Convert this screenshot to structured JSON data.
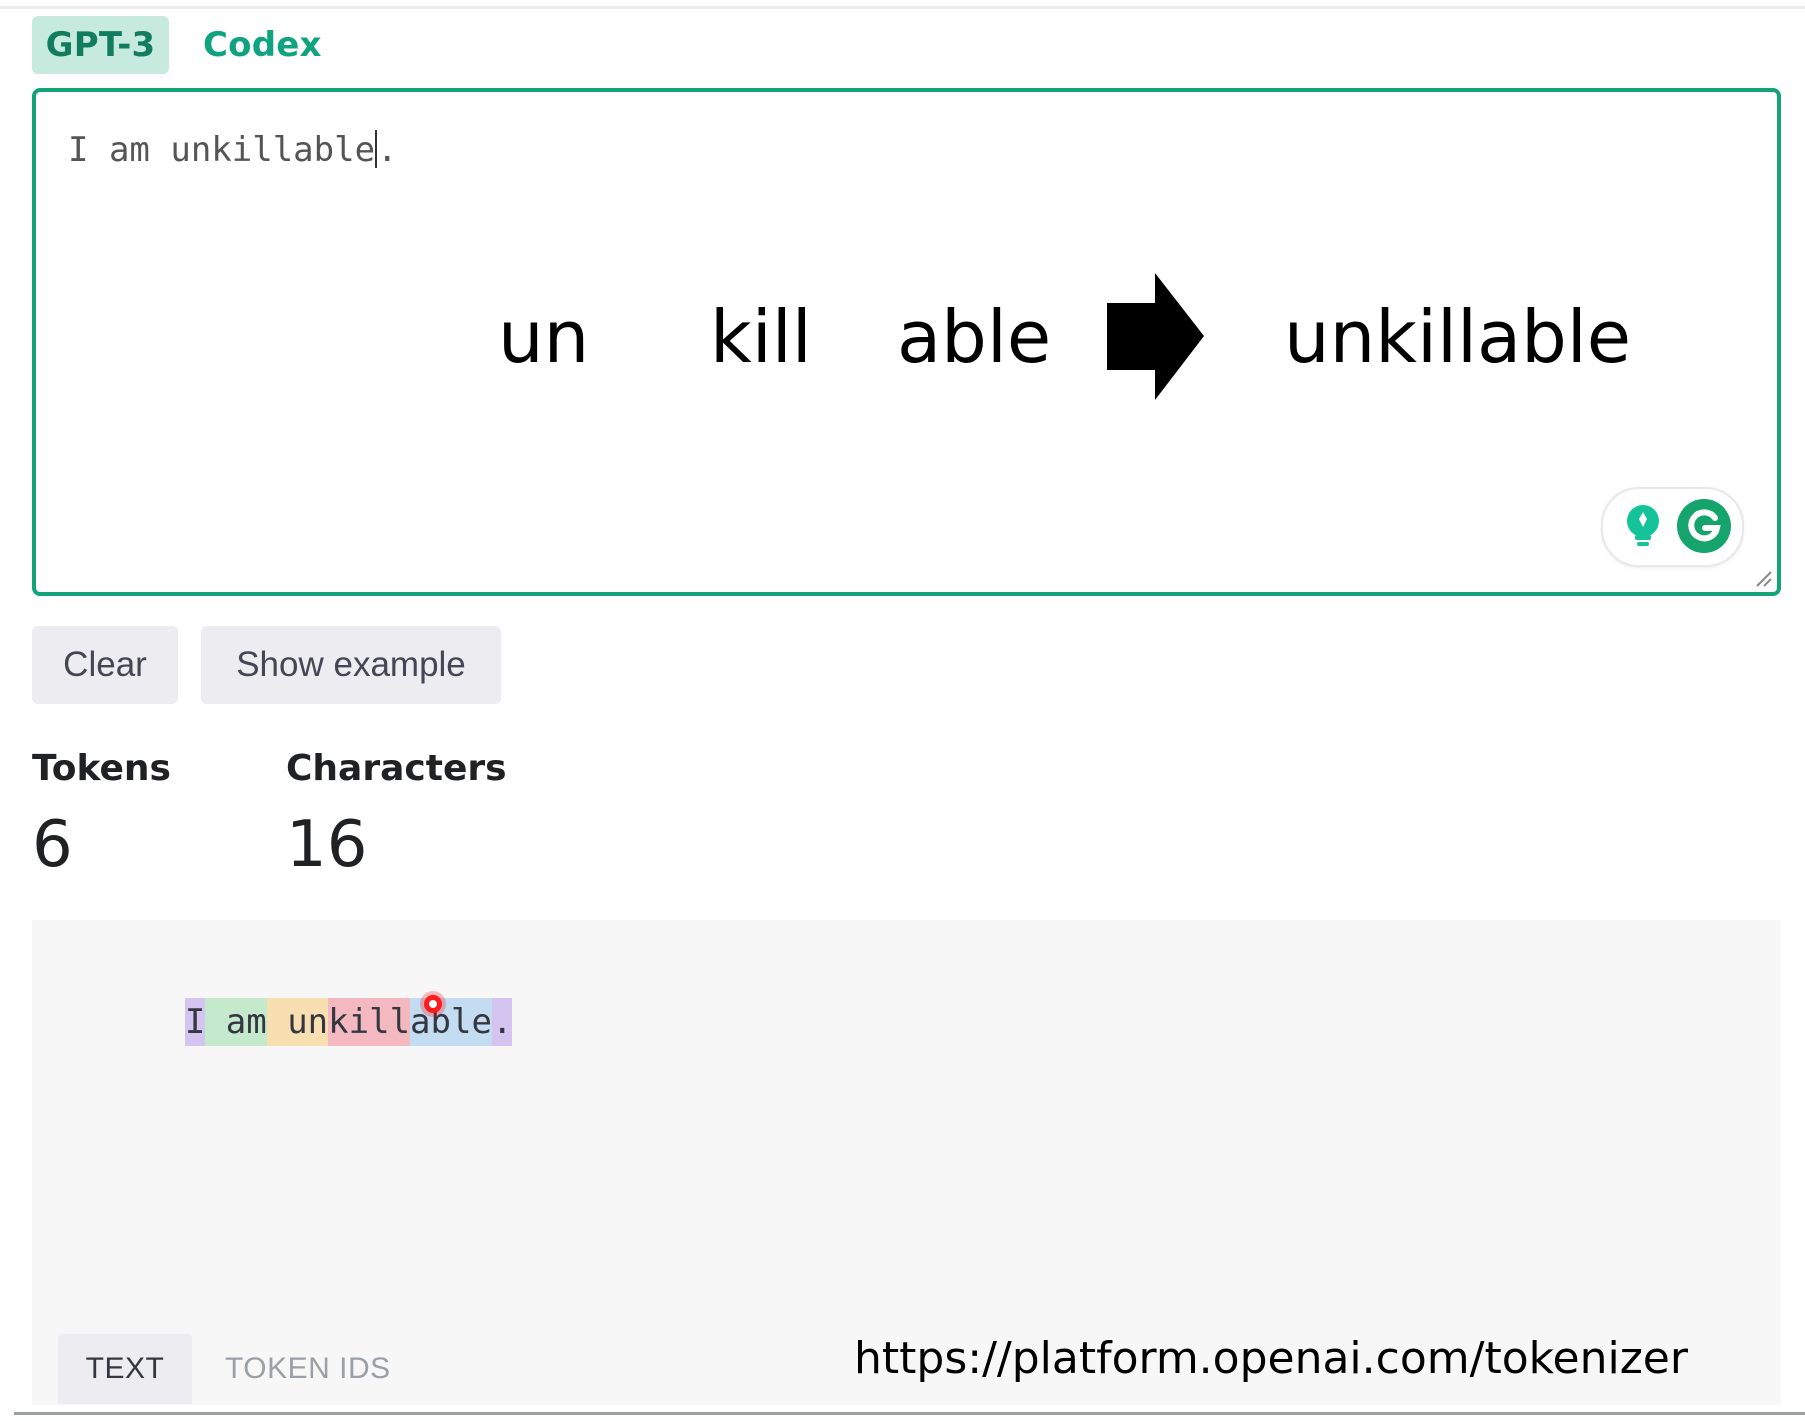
{
  "tabs": [
    {
      "label": "GPT-3",
      "active": true
    },
    {
      "label": "Codex",
      "active": false
    }
  ],
  "editor": {
    "value_before_caret": "I am unkillable",
    "value_after_caret": "."
  },
  "overlay": {
    "parts": [
      "un",
      "kill",
      "able"
    ],
    "result": "unkillable"
  },
  "buttons": {
    "clear": "Clear",
    "show_example": "Show example"
  },
  "stats": {
    "tokens_label": "Tokens",
    "tokens_value": "6",
    "characters_label": "Characters",
    "characters_value": "16"
  },
  "tokenized": [
    {
      "text": "I",
      "color": "#d4c4ef"
    },
    {
      "text": " am",
      "color": "#c5e9cc"
    },
    {
      "text": " un",
      "color": "#f8dfb1"
    },
    {
      "text": "kill",
      "color": "#f4b9c0"
    },
    {
      "text": "able",
      "color": "#c3dcf2"
    },
    {
      "text": ".",
      "color": "#d4c4ef"
    }
  ],
  "view_tabs": {
    "text": "TEXT",
    "token_ids": "TOKEN IDS"
  },
  "url": "https://platform.openai.com/tokenizer",
  "colors": {
    "accent": "#10a37f",
    "border": "#13a37a",
    "panel": "#f7f7f8",
    "button_bg": "#ececf1"
  }
}
